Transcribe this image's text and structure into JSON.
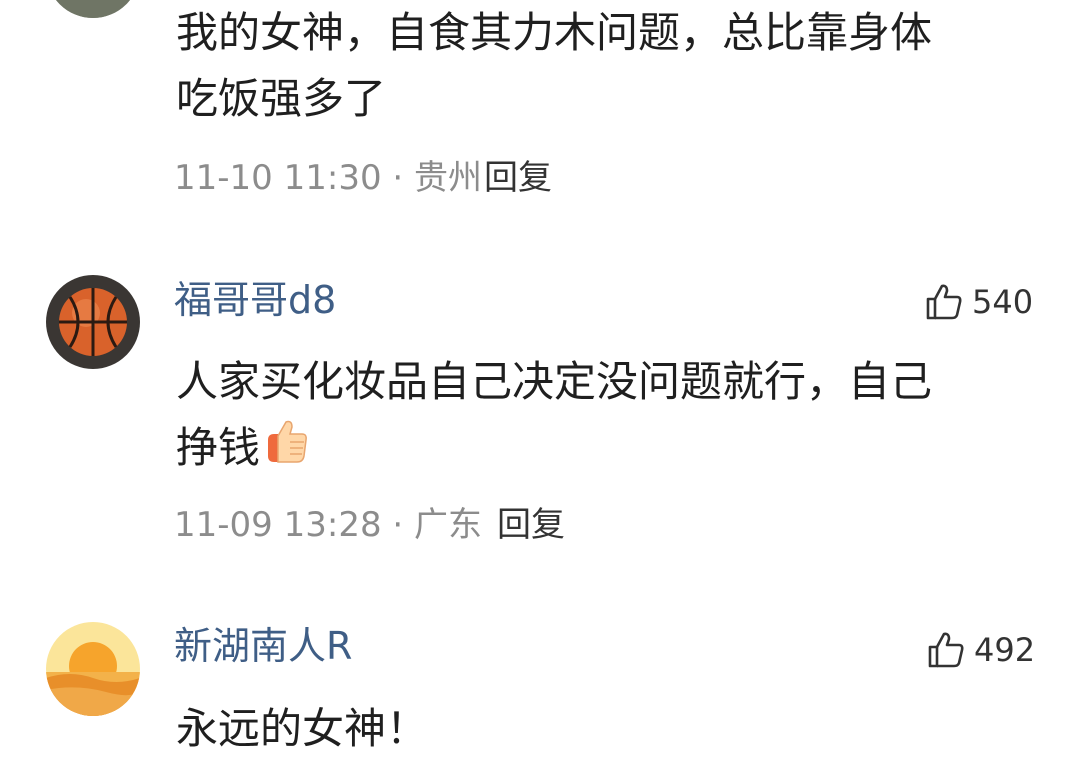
{
  "comments": [
    {
      "text_lines": [
        "我的女神，自食其力木问题，总比靠身体",
        "吃饭强多了"
      ],
      "meta": "11-10 11:30 · 贵州",
      "reply_label": "回复"
    },
    {
      "username": "福哥哥d8",
      "likes": "540",
      "text_lines": [
        "人家买化妆品自己决定没问题就行，自己",
        "挣钱"
      ],
      "emoji": "thumbs-up-emoji",
      "avatar_icon": "basketball-icon",
      "meta": "11-09 13:28 · 广东",
      "reply_label": "回复"
    },
    {
      "username": "新湖南人R",
      "likes": "492",
      "text_lines": [
        "永远的女神！"
      ],
      "avatar_icon": "sunset-icon"
    }
  ],
  "icons": {
    "like": "thumbs-up-outline-icon"
  },
  "colors": {
    "username": "#3f5e86",
    "meta": "#8c8c8c",
    "text": "#1f1f1f"
  }
}
